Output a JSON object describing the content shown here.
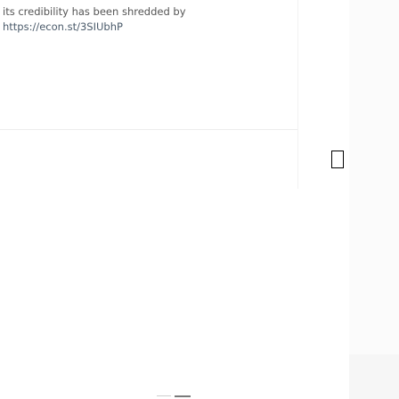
{
  "tweet": {
    "text_line": "its credibility has been shredded by",
    "link": "https://econ.st/3SIUbhP"
  },
  "colors": {
    "text": "#555555",
    "link": "#4a5a6a",
    "box_border": "#000000"
  }
}
